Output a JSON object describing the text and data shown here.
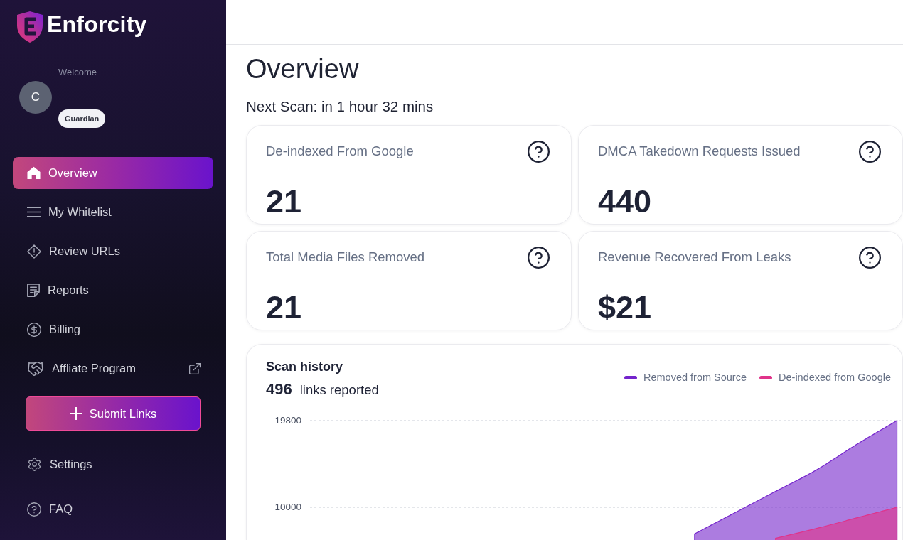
{
  "sidebar": {
    "brand": "Enforcity",
    "user": {
      "greeting": "Welcome",
      "initial": "C",
      "role": "Guardian"
    },
    "nav_items": [
      {
        "label": "Overview",
        "selected": true,
        "external": false
      },
      {
        "label": "My Whitelist",
        "selected": false,
        "external": false
      },
      {
        "label": "Review URLs",
        "selected": false,
        "external": false
      },
      {
        "label": "Reports",
        "selected": false,
        "external": false
      },
      {
        "label": "Billing",
        "selected": false,
        "external": false
      },
      {
        "label": "Affliate Program",
        "selected": false,
        "external": true
      }
    ],
    "submit_button": {
      "label": "Submit Links"
    },
    "bottom_items": [
      {
        "label": "Settings",
        "selected": false
      },
      {
        "label": "FAQ",
        "selected": false
      }
    ]
  },
  "main": {
    "title": "Overview",
    "next_scan": "Next Scan: in 1 hour 32 mins",
    "stats": [
      {
        "label": "De-indexed From Google",
        "value": "21"
      },
      {
        "label": "DMCA Takedown Requests Issued",
        "value": "440"
      },
      {
        "label": "Total Media Files Removed",
        "value": "21"
      },
      {
        "label": "Revenue Recovered From Leaks",
        "value": "$21"
      }
    ],
    "scan_history": {
      "title": "Scan history",
      "total": "496",
      "total_label": "links reported",
      "chart_data": {
        "type": "area",
        "legend": "top-right",
        "grid": true,
        "ylim": [
          6225,
          19800
        ],
        "yticks": [
          10000,
          19800
        ],
        "categories": [
          null,
          null,
          null,
          null,
          null,
          null,
          null,
          null,
          null,
          null,
          null,
          null,
          null,
          null,
          null
        ],
        "series": [
          {
            "name": "Removed from Source",
            "color": "#7424cc",
            "values": [
              null,
              null,
              null,
              null,
              null,
              null,
              null,
              null,
              null,
              7000,
              9400,
              11800,
              14200,
              17100,
              19800
            ]
          },
          {
            "name": "De-indexed from Google",
            "color": "#e0338a",
            "values": [
              null,
              null,
              null,
              null,
              null,
              null,
              null,
              null,
              null,
              null,
              null,
              6500,
              7600,
              8800,
              10000
            ]
          }
        ]
      }
    }
  }
}
